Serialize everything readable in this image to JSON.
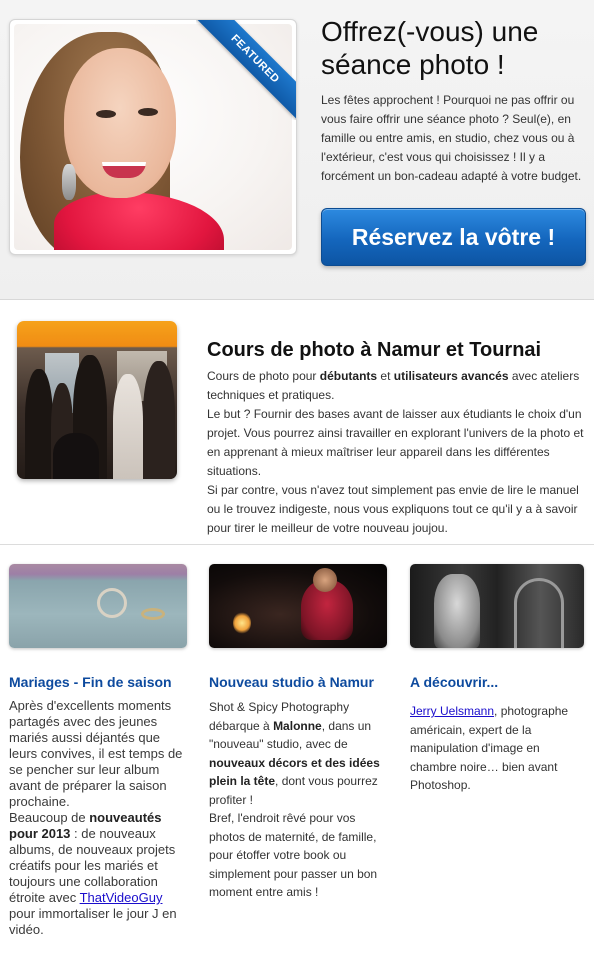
{
  "hero": {
    "ribbon_label": "FEATURED",
    "title": "Offrez(-vous) une séance photo !",
    "text": "Les fêtes approchent ! Pourquoi ne pas offrir ou vous faire offrir une séance photo ? Seul(e), en famille ou entre amis, en studio, chez vous ou à l'extérieur, c'est vous qui choisissez ! Il y a forcément un bon-cadeau adapté à votre budget.",
    "cta_label": "Réservez la vôtre !"
  },
  "course": {
    "title": "Cours de photo à Namur et Tournai",
    "p1_a": "Cours de photo pour ",
    "p1_b": "débutants",
    "p1_c": " et ",
    "p1_d": "utilisateurs avancés",
    "p1_e": " avec ateliers techniques et pratiques.",
    "p2": "Le but ? Fournir des bases avant de laisser aux étudiants le choix d'un projet. Vous pourrez ainsi travailler en explorant l'univers de la photo et en apprenant à mieux maîtriser leur appareil dans les différentes situations.",
    "p3": "Si par contre, vous n'avez tout simplement pas envie de lire le manuel ou le trouvez indigeste, nous vous expliquons tout ce qu'il y a à savoir pour tirer le meilleur de votre nouveau joujou."
  },
  "columns": {
    "weddings": {
      "title": "Mariages - Fin de saison",
      "t1": "Après d'excellents moments partagés avec des jeunes mariés aussi déjantés que leurs convives, il est temps de se pencher sur leur album avant de préparer la saison prochaine.",
      "t2": "Beaucoup de ",
      "t3": "nouveautés pour 2013",
      "t4": " : de nouveaux albums, de nouveaux projets créatifs pour les mariés et toujours une collaboration étroite avec ",
      "link": "ThatVideoGuy",
      "t5": " pour immortaliser le jour J en vidéo."
    },
    "studio": {
      "title": "Nouveau studio à Namur",
      "t1": "Shot & Spicy Photography débarque à ",
      "t2": "Malonne",
      "t3": ", dans un \"nouveau\" studio, avec de ",
      "t4": "nouveaux décors et des idées plein la tête",
      "t5": ", dont vous pourrez profiter !",
      "t6": "Bref, l'endroit rêvé pour vos photos de maternité, de famille, pour étoffer votre book ou simplement pour passer un bon moment entre amis !"
    },
    "discover": {
      "title": "A découvrir...",
      "link": "Jerry Uelsmann",
      "t1": ", photographe américain, expert de la manipulation d'image en chambre noire… bien avant Photoshop."
    }
  }
}
